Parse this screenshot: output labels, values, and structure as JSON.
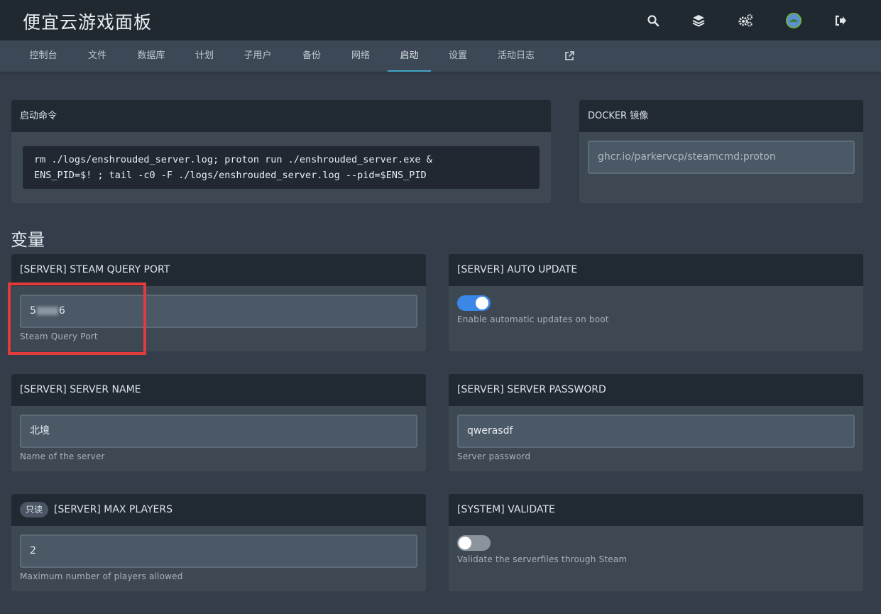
{
  "app": {
    "title": "便宜云游戏面板",
    "icons": [
      "search-icon",
      "layers-icon",
      "cogs-icon",
      "avatar",
      "sign-out-icon"
    ]
  },
  "nav": {
    "tabs": [
      "控制台",
      "文件",
      "数据库",
      "计划",
      "子用户",
      "备份",
      "网络",
      "启动",
      "设置",
      "活动日志"
    ],
    "active": "启动",
    "external_icon": "external-link-icon"
  },
  "startup": {
    "title": "启动命令",
    "command_line1": "rm ./logs/enshrouded_server.log; proton run ./enshrouded_server.exe &",
    "command_line2": "ENS_PID=$! ; tail -c0 -F ./logs/enshrouded_server.log --pid=$ENS_PID"
  },
  "docker": {
    "title": "DOCKER 镜像",
    "image": "ghcr.io/parkervcp/steamcmd:proton"
  },
  "variables_title": "变量",
  "variables": {
    "query_port": {
      "title": "[SERVER] STEAM QUERY PORT",
      "value_prefix": "5",
      "value_suffix": "6",
      "hint": "Steam Query Port"
    },
    "auto_update": {
      "title": "[SERVER] AUTO UPDATE",
      "enabled": true,
      "hint": "Enable automatic updates on boot"
    },
    "server_name": {
      "title": "[SERVER] SERVER NAME",
      "value": "北境",
      "hint": "Name of the server"
    },
    "server_password": {
      "title": "[SERVER] SERVER PASSWORD",
      "value": "qwerasdf",
      "hint": "Server password"
    },
    "max_players": {
      "badge": "只读",
      "title": "[SERVER] MAX PLAYERS",
      "value": "2",
      "hint": "Maximum number of players allowed"
    },
    "validate": {
      "title": "[SYSTEM] VALIDATE",
      "enabled": false,
      "hint": "Validate the serverfiles through Steam"
    }
  },
  "colors": {
    "accent": "#3fa6c6",
    "toggle_on": "#3b87e8",
    "highlight": "#e23b3b"
  }
}
